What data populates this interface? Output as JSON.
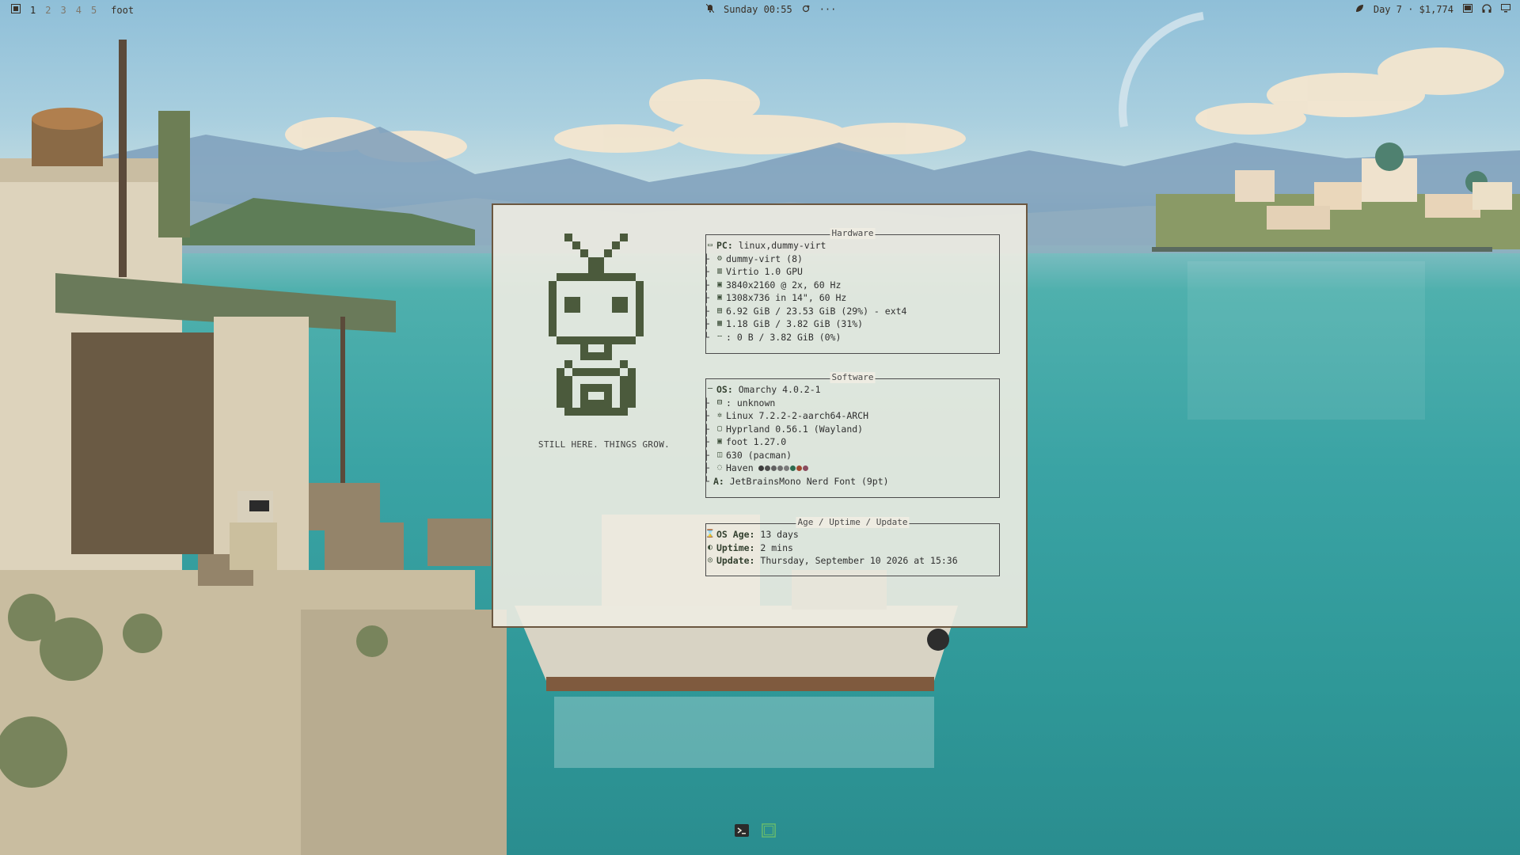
{
  "topbar": {
    "left": {
      "workspaces": [
        "1",
        "2",
        "3",
        "4",
        "5"
      ],
      "active_workspace": "1",
      "window_title": "foot"
    },
    "center": {
      "datetime": "Sunday 00:55",
      "more": "···"
    },
    "right": {
      "status": "Day 7 · $1,774"
    }
  },
  "terminal": {
    "motto": "STILL HERE. THINGS GROW.",
    "hardware": {
      "title": "Hardware",
      "rows": [
        {
          "key": "PC:",
          "value": " linux,dummy-virt"
        },
        {
          "key": "",
          "value": "dummy-virt (8)"
        },
        {
          "key": "",
          "value": "Virtio 1.0 GPU"
        },
        {
          "key": "",
          "value": "3840x2160 @ 2x, 60 Hz"
        },
        {
          "key": "",
          "value": "1308x736 in 14\", 60 Hz"
        },
        {
          "key": "",
          "value": "6.92 GiB / 23.53 GiB (29%) - ext4"
        },
        {
          "key": "",
          "value": "1.18 GiB / 3.82 GiB (31%)"
        },
        {
          "key": "",
          "value": ": 0 B / 3.82 GiB (0%)"
        }
      ]
    },
    "software": {
      "title": "Software",
      "rows": [
        {
          "key": "OS:",
          "value": " Omarchy 4.0.2-1"
        },
        {
          "key": "",
          "value": ": unknown"
        },
        {
          "key": "",
          "value": "Linux 7.2.2-2-aarch64-ARCH"
        },
        {
          "key": "",
          "value": "Hyprland 0.56.1 (Wayland)"
        },
        {
          "key": "",
          "value": "foot 1.27.0"
        },
        {
          "key": "",
          "value": "630 (pacman)"
        },
        {
          "key": "",
          "value": "Haven"
        },
        {
          "key": "A:",
          "value": " JetBrainsMono Nerd Font (9pt)"
        }
      ],
      "theme_colors": [
        "#3b3b3b",
        "#4e4e4e",
        "#606060",
        "#6f6f6f",
        "#7b7b7b",
        "#2e6b4f",
        "#a0472f",
        "#8a4b5e"
      ]
    },
    "age": {
      "title": "Age / Uptime / Update",
      "rows": [
        {
          "key": "OS Age:",
          "value": " 13 days"
        },
        {
          "key": "Uptime:",
          "value": " 2 mins"
        },
        {
          "key": "Update:",
          "value": " Thursday, September 10 2026 at 15:36"
        }
      ]
    }
  },
  "colors": {
    "accent_green": "#4b5a3c",
    "frame": "#6b5740",
    "terminal_bg": "#eeece2"
  },
  "icons": {
    "hardware": [
      "monitor-icon",
      "cpu-icon",
      "gpu-icon",
      "display-icon",
      "display-icon",
      "disk-icon",
      "memory-icon",
      "swap-icon"
    ],
    "software": [
      "os-icon",
      "kernel-icon",
      "linux-icon",
      "wm-icon",
      "terminal-icon",
      "package-icon",
      "theme-icon",
      "font-icon"
    ],
    "age": [
      "hourglass-icon",
      "uptime-icon",
      "update-icon"
    ]
  }
}
